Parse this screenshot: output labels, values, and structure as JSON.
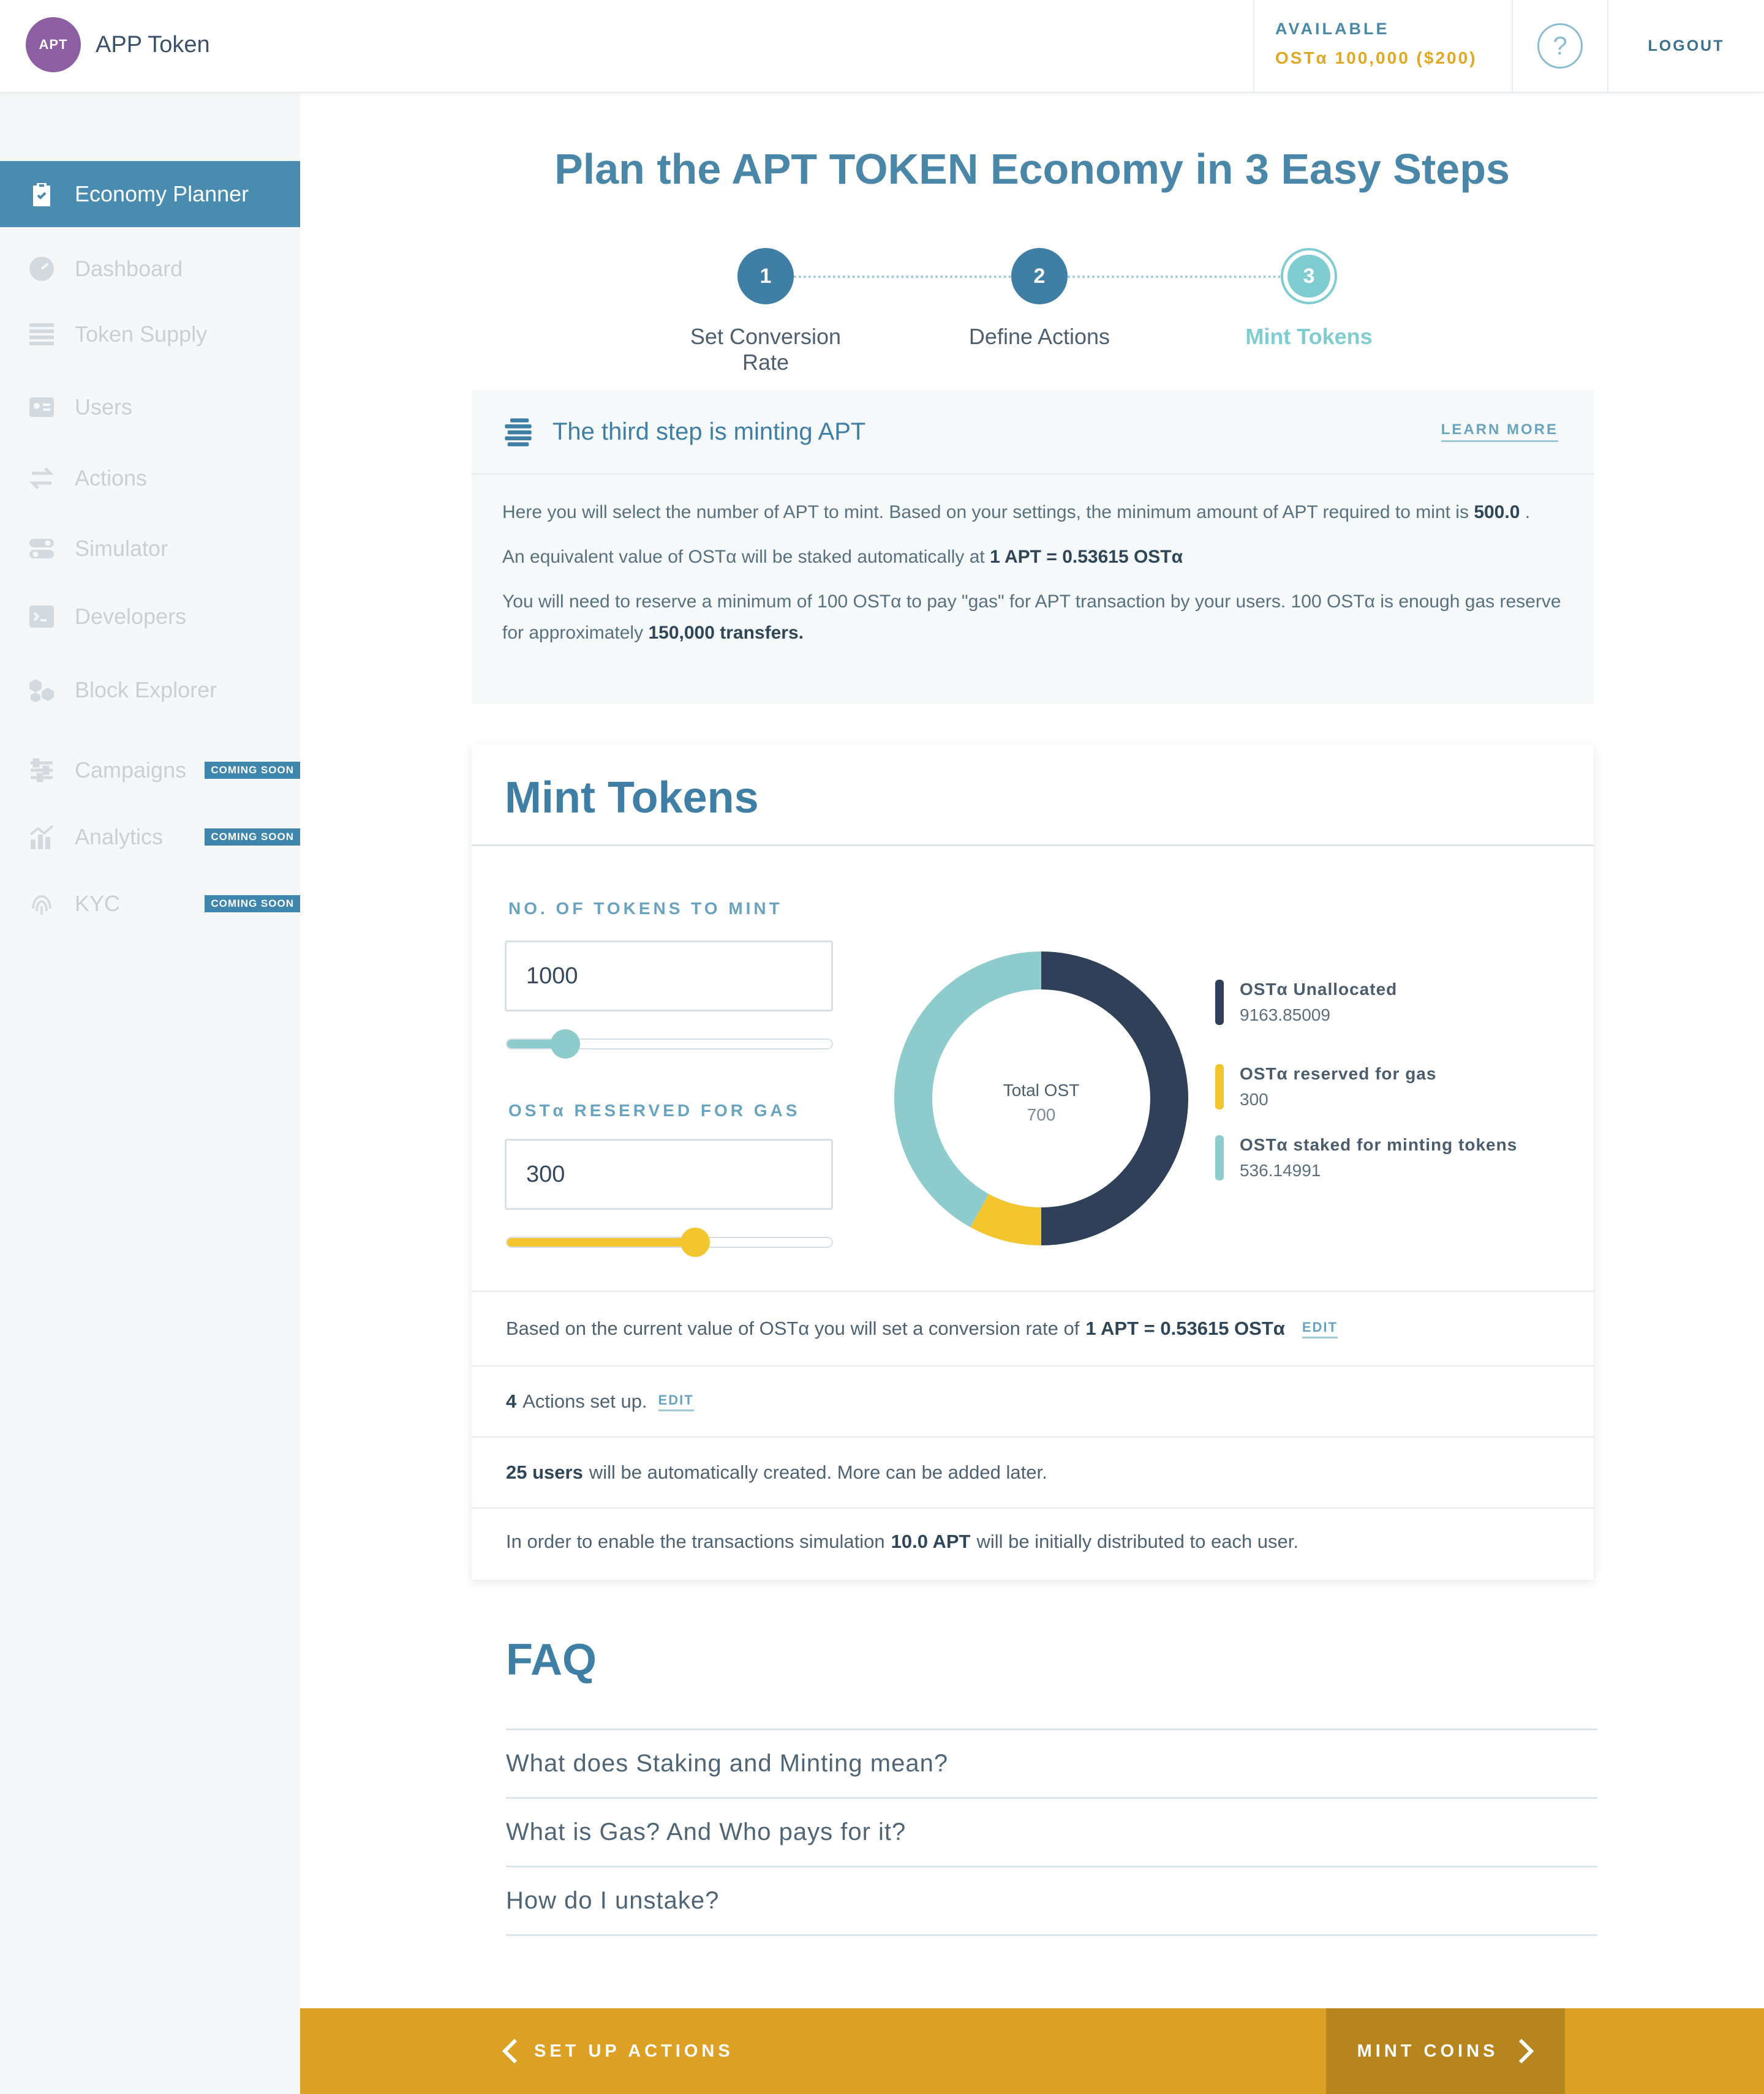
{
  "header": {
    "avatar": "APT",
    "app_name": "APP Token",
    "balance_label": "AVAILABLE",
    "balance_value": "OSTα 100,000 ($200)",
    "help": "?",
    "logout": "LOGOUT"
  },
  "sidebar": {
    "items": [
      {
        "label": "Economy Planner",
        "icon": "clipboard-check-icon",
        "active": true
      },
      {
        "label": "Dashboard",
        "icon": "speedometer-icon"
      },
      {
        "label": "Token Supply",
        "icon": "stack-icon"
      },
      {
        "label": "Users",
        "icon": "id-card-icon"
      },
      {
        "label": "Actions",
        "icon": "swap-arrows-icon"
      },
      {
        "label": "Simulator",
        "icon": "toggles-icon"
      },
      {
        "label": "Developers",
        "icon": "terminal-icon"
      },
      {
        "label": "Block Explorer",
        "icon": "cubes-icon"
      },
      {
        "label": "Campaigns",
        "icon": "sliders-icon",
        "badge": "COMING SOON"
      },
      {
        "label": "Analytics",
        "icon": "chart-icon",
        "badge": "COMING SOON"
      },
      {
        "label": "KYC",
        "icon": "fingerprint-icon",
        "badge": "COMING SOON"
      }
    ]
  },
  "page_title": "Plan the APT TOKEN Economy in 3 Easy Steps",
  "steps": [
    {
      "num": "1",
      "label": "Set Conversion Rate"
    },
    {
      "num": "2",
      "label": "Define Actions"
    },
    {
      "num": "3",
      "label": "Mint Tokens"
    }
  ],
  "info": {
    "title": "The third step is minting APT",
    "learn_more": "LEARN MORE",
    "p1_a": "Here you will select the number of APT to mint. Based on your settings, the minimum amount of APT required to mint is",
    "p1_b": "500.0",
    "p1_c": ".",
    "p2_a": "An equivalent value of OSTα will be staked automatically at",
    "p2_b": "1 APT = 0.53615 OSTα",
    "p3_a": "You will need to reserve a minimum of 100 OSTα to pay \"gas\" for APT transaction by your users. 100 OSTα is enough gas reserve for approximately",
    "p3_b": "150,000 transfers."
  },
  "mint": {
    "title": "Mint Tokens",
    "tokens_label": "NO. OF TOKENS TO MINT",
    "tokens_value": "1000",
    "tokens_slider": 0.18,
    "gas_label": "OSTα RESERVED FOR GAS",
    "gas_value": "300",
    "gas_slider": 0.58
  },
  "chart_data": {
    "type": "pie",
    "center_label": "Total OST",
    "center_value": "700",
    "series": [
      {
        "name": "OSTα Unallocated",
        "display": "9163.85009",
        "share": 0.5,
        "color": "#2f4058"
      },
      {
        "name": "OSTα reserved for gas",
        "display": "300",
        "share": 0.08,
        "color": "#f3c52e"
      },
      {
        "name": "OSTα staked for minting tokens",
        "display": "536.14991",
        "share": 0.42,
        "color": "#8dcbcd"
      }
    ]
  },
  "summary": {
    "row1_a": "Based on the current value of OSTα you will set a conversion rate of",
    "row1_b": "1 APT = 0.53615 OSTα",
    "row1_edit": "EDIT",
    "row2_a": "4",
    "row2_b": "Actions set up.",
    "row2_edit": "EDIT",
    "row3_a": "25 users",
    "row3_b": "will be automatically created. More can be added later.",
    "row4_a": "In order to enable the transactions simulation",
    "row4_b": "10.0 APT",
    "row4_c": "will be initially distributed to each user."
  },
  "faq": {
    "title": "FAQ",
    "items": [
      "What does Staking and Minting mean?",
      "What is Gas? And Who pays for it?",
      "How do I unstake?"
    ]
  },
  "footer": {
    "back": "SET UP ACTIONS",
    "primary": "MINT COINS"
  },
  "colors": {
    "accent": "#4a8bb0",
    "gold": "#dca124",
    "teal": "#7fcdd0"
  }
}
